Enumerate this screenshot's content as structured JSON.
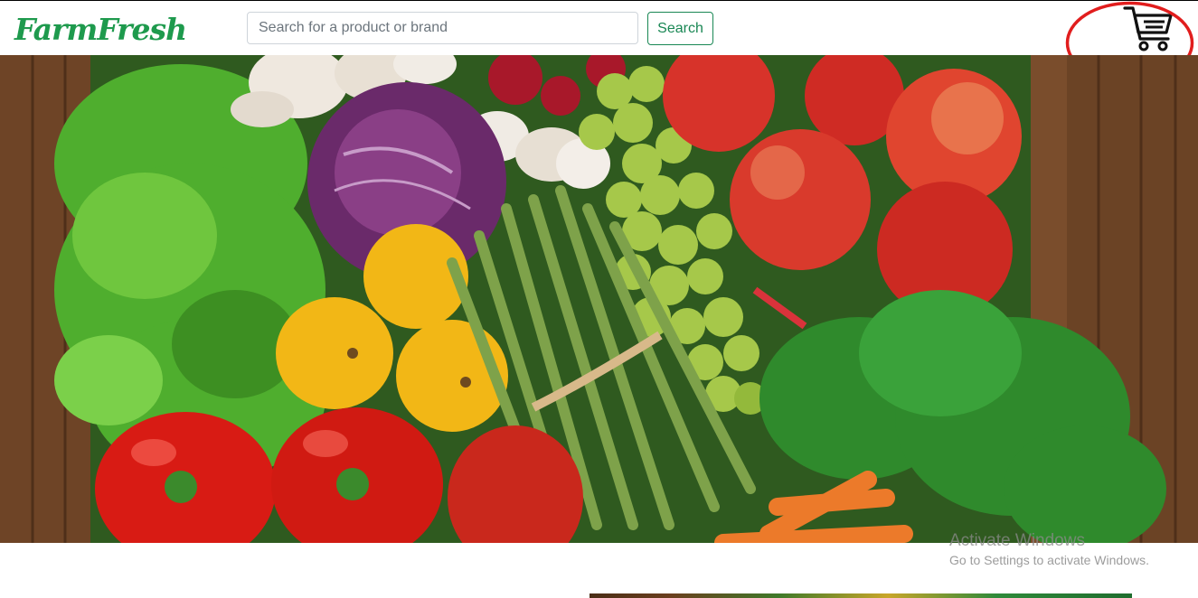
{
  "brand": {
    "name": "FarmFresh",
    "logo_icon": "grocery-bag-icon"
  },
  "search": {
    "placeholder": "Search for a product or brand",
    "value": "",
    "button_label": "Search"
  },
  "cart": {
    "icon": "shopping-cart-icon",
    "highlight_color": "#e11d1d"
  },
  "hero": {
    "image": "fresh-vegetables-and-fruit-crate"
  },
  "watermark": {
    "title": "Activate Windows",
    "subtitle": "Go to Settings to activate Windows."
  },
  "colors": {
    "brand_green": "#1e9a4d",
    "button_green": "#198754",
    "border": "#ced4da"
  }
}
